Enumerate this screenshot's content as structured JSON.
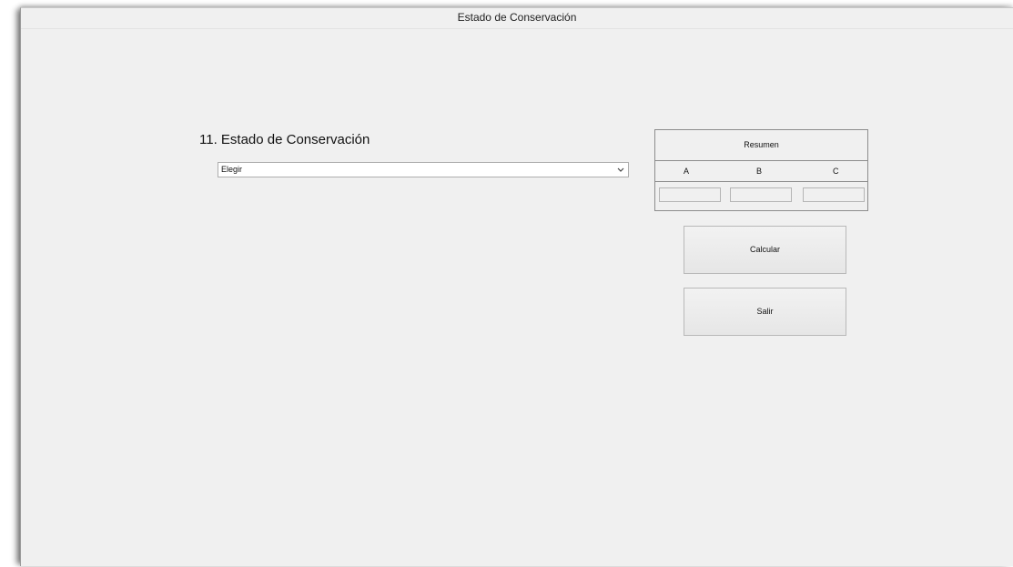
{
  "window": {
    "title": "Estado de Conservación"
  },
  "form": {
    "section_title": "11. Estado de Conservación",
    "combo_value": "Elegir"
  },
  "resumen": {
    "title": "Resumen",
    "columns": [
      "A",
      "B",
      "C"
    ],
    "values": [
      "",
      "",
      ""
    ]
  },
  "buttons": {
    "calcular": "Calcular",
    "salir": "Salir"
  },
  "icons": {
    "combo_arrow": "chevron-down-icon"
  }
}
